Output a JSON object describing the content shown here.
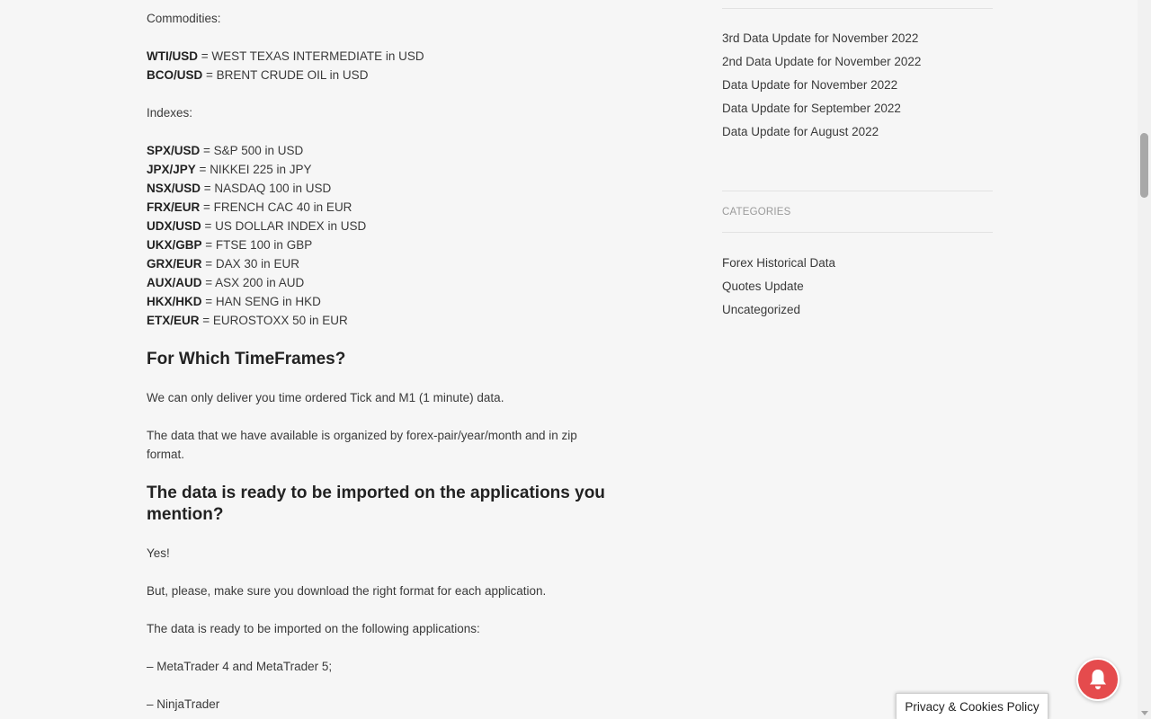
{
  "article": {
    "commodities_heading": "Commodities:",
    "commodities": [
      {
        "code": "WTI/USD",
        "desc": "WEST TEXAS INTERMEDIATE in USD"
      },
      {
        "code": "BCO/USD",
        "desc": "BRENT CRUDE OIL in USD"
      }
    ],
    "indexes_heading": "Indexes:",
    "indexes": [
      {
        "code": "SPX/USD",
        "desc": "S&P 500 in USD"
      },
      {
        "code": "JPX/JPY",
        "desc": "NIKKEI 225 in JPY"
      },
      {
        "code": "NSX/USD",
        "desc": "NASDAQ 100 in USD"
      },
      {
        "code": "FRX/EUR",
        "desc": "FRENCH CAC 40 in EUR"
      },
      {
        "code": "UDX/USD",
        "desc": "US DOLLAR INDEX in USD"
      },
      {
        "code": "UKX/GBP",
        "desc": "FTSE 100 in GBP"
      },
      {
        "code": "GRX/EUR",
        "desc": "DAX 30 in EUR"
      },
      {
        "code": "AUX/AUD",
        "desc": "ASX 200 in AUD"
      },
      {
        "code": "HKX/HKD",
        "desc": "HAN SENG in HKD"
      },
      {
        "code": "ETX/EUR",
        "desc": "EUROSTOXX 50 in EUR"
      }
    ],
    "timeframes_heading": "For Which TimeFrames?",
    "timeframes_p1": "We can only deliver you time ordered Tick and M1 (1 minute) data.",
    "timeframes_p2": "The data that we have available is organized by forex-pair/year/month and in zip format.",
    "import_heading": "The data is ready to be imported on the applications you mention?",
    "import_yes": "Yes!",
    "import_p1": "But, please, make sure you download the right format for each application.",
    "import_p2": "The data is ready to be imported on the following applications:",
    "apps": [
      "– MetaTrader 4 and MetaTrader 5;",
      "– NinjaTrader"
    ]
  },
  "sidebar": {
    "recent_posts": [
      "3rd Data Update for November 2022",
      "2nd Data Update for November 2022",
      "Data Update for November 2022",
      "Data Update for September 2022",
      "Data Update for August 2022"
    ],
    "categories_title": "CATEGORIES",
    "categories": [
      "Forex Historical Data",
      "Quotes Update",
      "Uncategorized"
    ]
  },
  "privacy": {
    "label": "Privacy & Cookies Policy"
  },
  "colors": {
    "bell": "#e54b4d",
    "background": "#f6f6f6",
    "text": "#3a3a3a"
  }
}
